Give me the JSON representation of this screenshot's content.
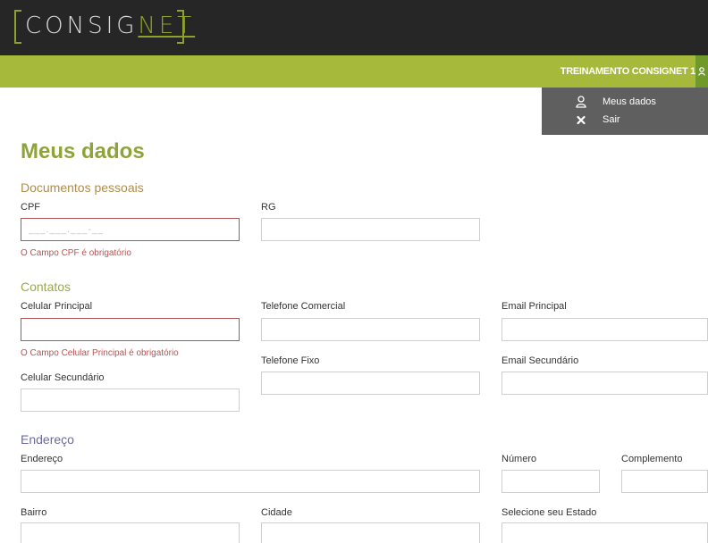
{
  "app": {
    "logo_prefix": "CONSIG",
    "logo_accent": "NET",
    "brand_color": "#8ca22c",
    "topbar_color": "#262626",
    "navbar_color": "#a6b93a"
  },
  "header": {
    "user_name": "TREINAMENTO CONSIGNET 1",
    "user_menu": [
      {
        "label": "Meus dados",
        "icon": "user-icon"
      },
      {
        "label": "Sair",
        "icon": "close-icon"
      }
    ]
  },
  "page": {
    "title": "Meus dados"
  },
  "sections": {
    "documentos": {
      "title": "Documentos pessoais",
      "cpf_label": "CPF",
      "cpf_placeholder": "___.___.___-__",
      "cpf_value": "",
      "cpf_error": "O Campo CPF é obrigatório",
      "rg_label": "RG",
      "rg_value": ""
    },
    "contatos": {
      "title": "Contatos",
      "celular_principal_label": "Celular Principal",
      "celular_principal_value": "",
      "celular_principal_error": "O Campo Celular Principal é obrigatório",
      "telefone_comercial_label": "Telefone Comercial",
      "telefone_comercial_value": "",
      "email_principal_label": "Email Principal",
      "email_principal_value": "",
      "celular_secundario_label": "Celular Secundário",
      "celular_secundario_value": "",
      "telefone_fixo_label": "Telefone Fixo",
      "telefone_fixo_value": "",
      "email_secundario_label": "Email Secundário",
      "email_secundario_value": ""
    },
    "endereco": {
      "title": "Endereço",
      "endereco_label": "Endereço",
      "endereco_value": "",
      "numero_label": "Número",
      "numero_value": "",
      "complemento_label": "Complemento",
      "complemento_value": "",
      "bairro_label": "Bairro",
      "bairro_value": "",
      "cidade_label": "Cidade",
      "cidade_value": "",
      "estado_label": "Selecione seu Estado",
      "estado_value": ""
    }
  }
}
